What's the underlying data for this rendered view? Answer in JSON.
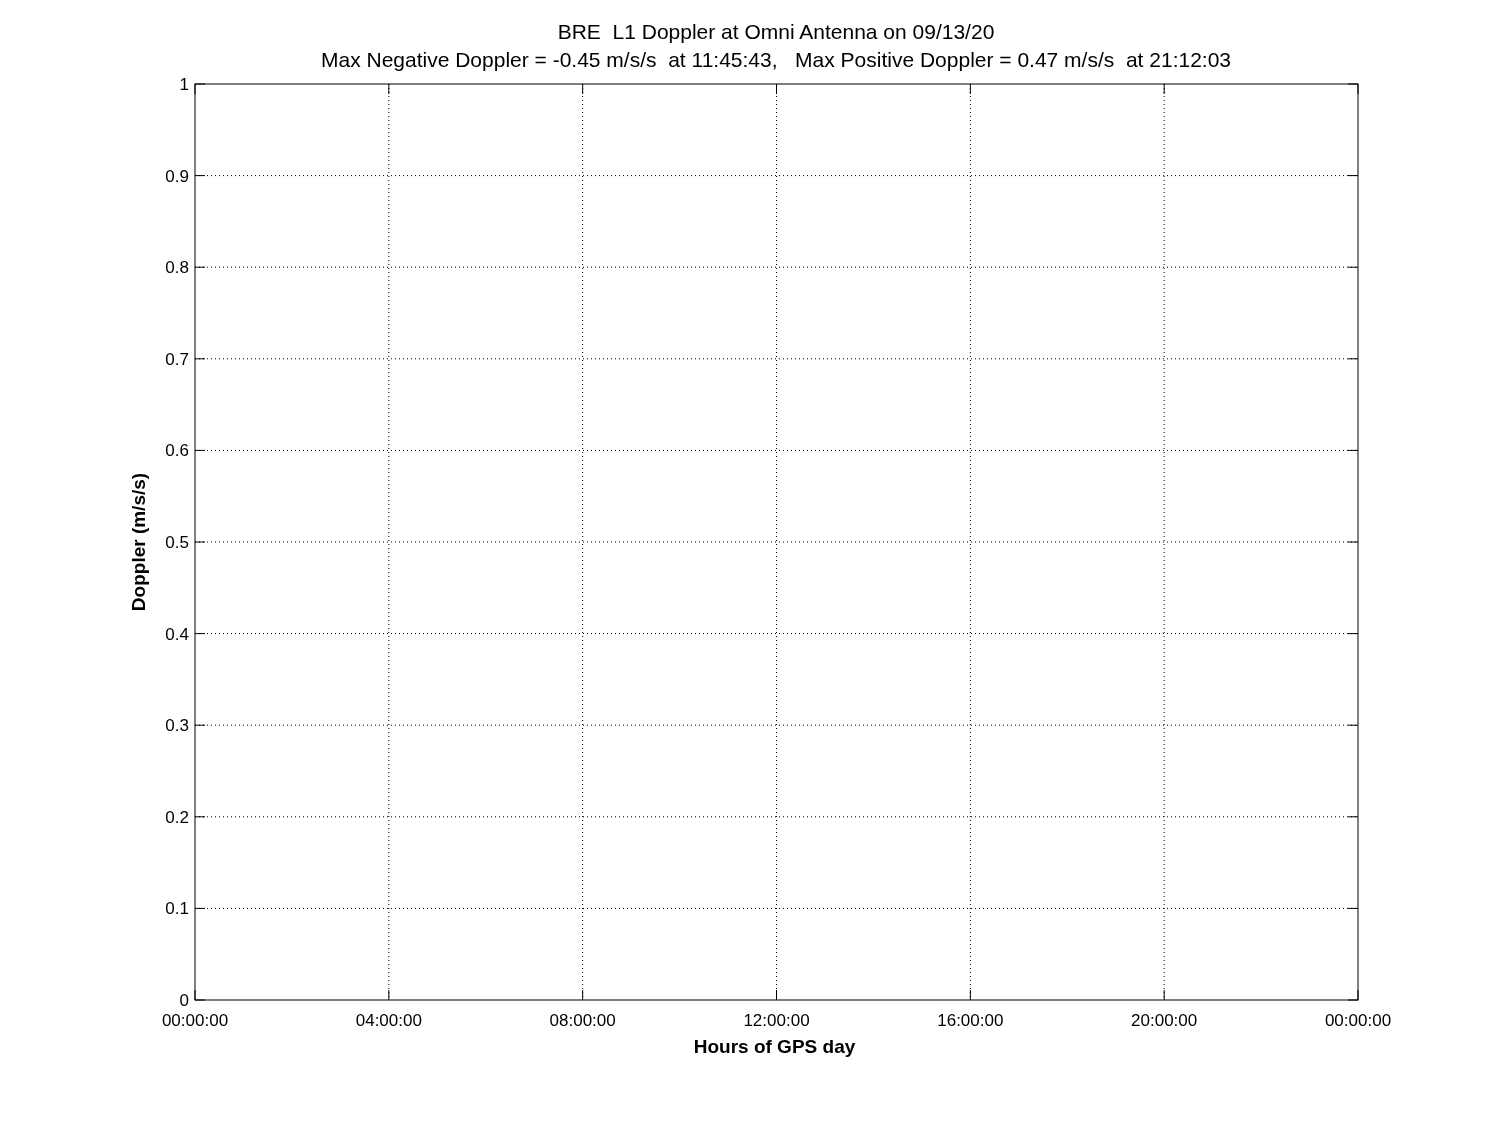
{
  "figure": {
    "subtitle": "Max Negative Doppler = -0.45 m/s/s  at 11:45:43,   Max Positive Doppler = 0.47 m/s/s  at 21:12:03",
    "chart_data": {
      "type": "line",
      "title": "BRE  L1 Doppler at Omni Antenna on 09/13/20",
      "xlabel": "Hours of GPS day",
      "ylabel": "Doppler (m/s/s)",
      "grid": true,
      "ylim": [
        0,
        1
      ],
      "categories": [
        "00:00:00",
        "04:00:00",
        "08:00:00",
        "12:00:00",
        "16:00:00",
        "20:00:00",
        "00:00:00"
      ],
      "yticks": [
        {
          "value": 0,
          "label": "0"
        },
        {
          "value": 0.1,
          "label": "0.1"
        },
        {
          "value": 0.2,
          "label": "0.2"
        },
        {
          "value": 0.3,
          "label": "0.3"
        },
        {
          "value": 0.4,
          "label": "0.4"
        },
        {
          "value": 0.5,
          "label": "0.5"
        },
        {
          "value": 0.6,
          "label": "0.6"
        },
        {
          "value": 0.7,
          "label": "0.7"
        },
        {
          "value": 0.8,
          "label": "0.8"
        },
        {
          "value": 0.9,
          "label": "0.9"
        },
        {
          "value": 1,
          "label": "1"
        }
      ]
    }
  }
}
